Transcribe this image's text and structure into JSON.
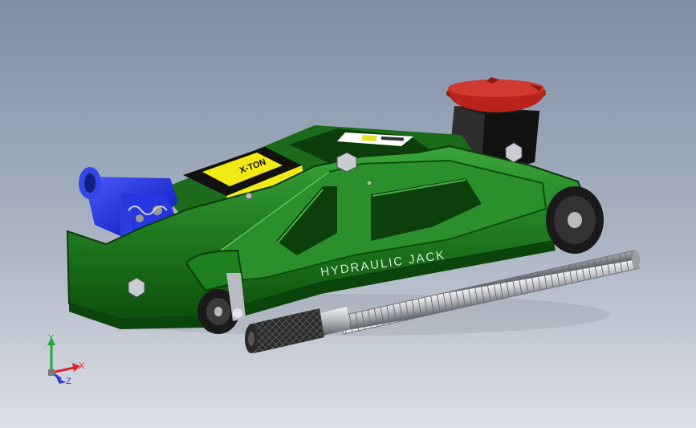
{
  "model": {
    "sticker_text": "X-TON",
    "side_text": "HYDRAULIC JACK",
    "colors": {
      "frame": "#1f7a1f",
      "frame_dark": "#0e4f0e",
      "frame_light": "#3aa63a",
      "pump": "#1f2fd0",
      "saddle": "#b8231c",
      "sticker": "#f2ea16",
      "handle": "#b9bcc2",
      "wheel": "#2a2a2a"
    }
  },
  "triad": {
    "x_label": "X",
    "y_label": "Y",
    "z_label": "Z",
    "colors": {
      "x": "#d8242a",
      "y": "#2aa33a",
      "z": "#2a3fd0"
    }
  }
}
